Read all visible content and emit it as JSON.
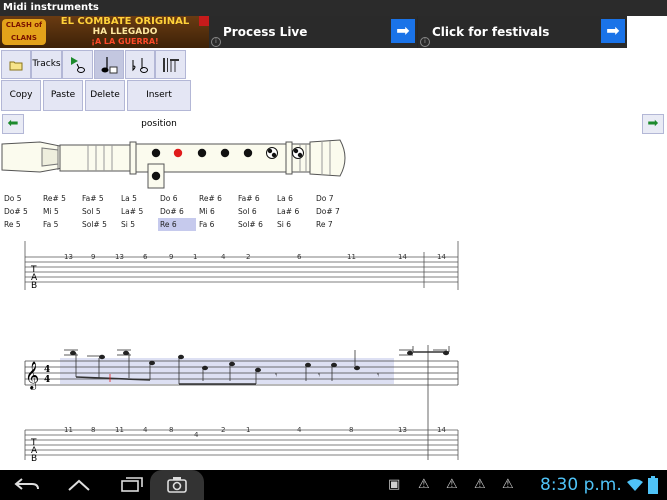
{
  "window": {
    "title": "Midi instruments"
  },
  "ads": {
    "clash": {
      "logo": "CLASH of CLANS",
      "line1": "EL COMBATE ORIGINAL",
      "line2": "HA LLEGADO",
      "line3": "¡A LA GUERRA!"
    },
    "process_live": "Process Live",
    "festivals": "Click for festivals",
    "arrow_icon": "arrow-right-icon"
  },
  "toolbar": {
    "tracks_label": "Tracks",
    "copy_label": "Copy",
    "paste_label": "Paste",
    "delete_label": "Delete",
    "insert_label": "Insert position"
  },
  "notes": [
    [
      "Do 5",
      "Re# 5",
      "Fa# 5",
      "La 5",
      "Do 6",
      "Re# 6",
      "Fa# 6",
      "La 6",
      "Do 7"
    ],
    [
      "Do# 5",
      "Mi 5",
      "Sol 5",
      "La# 5",
      "Do# 6",
      "Mi 6",
      "Sol 6",
      "La# 6",
      "Do# 7"
    ],
    [
      "Re 5",
      "Fa 5",
      "Sol# 5",
      "Si 5",
      "Re 6",
      "Fa 6",
      "Sol# 6",
      "Si 6",
      "Re 7"
    ]
  ],
  "selected_note": "Re 6",
  "staff1": {
    "tab_letters": [
      "T",
      "A",
      "B"
    ],
    "numbers": [
      "13",
      "9",
      "13",
      "6",
      "9",
      "1",
      "4",
      "2",
      "6",
      "11",
      "14",
      "14"
    ]
  },
  "staff2": {
    "time_signature": [
      "4",
      "4"
    ],
    "tab_letters": [
      "T",
      "A",
      "B"
    ],
    "numbers": [
      "11",
      "8",
      "11",
      "4",
      "8",
      "4",
      "2",
      "1",
      "4",
      "8",
      "13",
      "14"
    ]
  },
  "system": {
    "time": "8:30 p.m."
  },
  "colors": {
    "accent": "#1a73e8",
    "selected_note": "#c6caed",
    "playing_hole": "#e01b1b",
    "clock": "#4fc3f7"
  }
}
